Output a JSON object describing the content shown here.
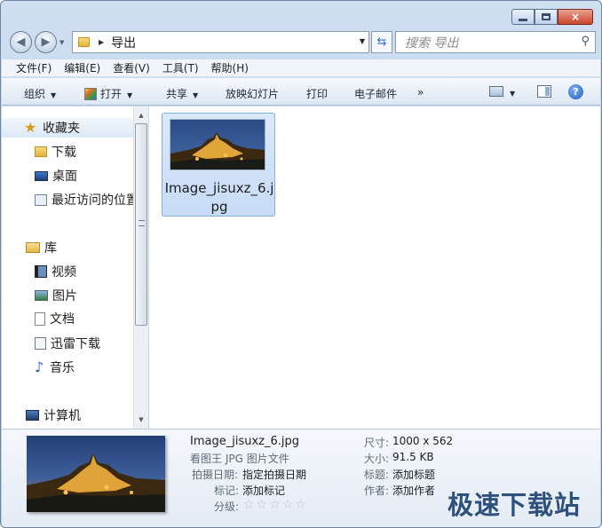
{
  "window": {
    "controls": {
      "minimize": "",
      "maximize": "",
      "close": "×"
    }
  },
  "address": {
    "crumb": "导出",
    "search_placeholder": "搜索 导出"
  },
  "menu": [
    "文件(F)",
    "编辑(E)",
    "查看(V)",
    "工具(T)",
    "帮助(H)"
  ],
  "commands": {
    "organize": "组织",
    "open": "打开",
    "share": "共享",
    "slideshow": "放映幻灯片",
    "print": "打印",
    "email": "电子邮件",
    "more": "»"
  },
  "nav": {
    "favorites": "收藏夹",
    "downloads": "下载",
    "desktop": "桌面",
    "recent": "最近访问的位置",
    "libraries": "库",
    "videos": "视频",
    "pictures": "图片",
    "documents": "文档",
    "xunlei": "迅雷下载",
    "music": "音乐",
    "computer": "计算机"
  },
  "file": {
    "name": "Image_jisuxz_6.jpg"
  },
  "details": {
    "filename": "Image_jisuxz_6.jpg",
    "type": "看图王 JPG 图片文件",
    "date_label": "拍摄日期:",
    "date_value": "指定拍摄日期",
    "tags_label": "标记:",
    "tags_value": "添加标记",
    "rating_label": "分级:",
    "rating_stars": "☆☆☆☆☆",
    "dim_label": "尺寸:",
    "dim_value": "1000 x 562",
    "size_label": "大小:",
    "size_value": "91.5 KB",
    "title_label": "标题:",
    "title_value": "添加标题",
    "author_label": "作者:",
    "author_value": "添加作者"
  },
  "watermark": "极速下载站",
  "colors": {
    "selection": "#c7dcf6",
    "accent": "#1f5cbf"
  }
}
